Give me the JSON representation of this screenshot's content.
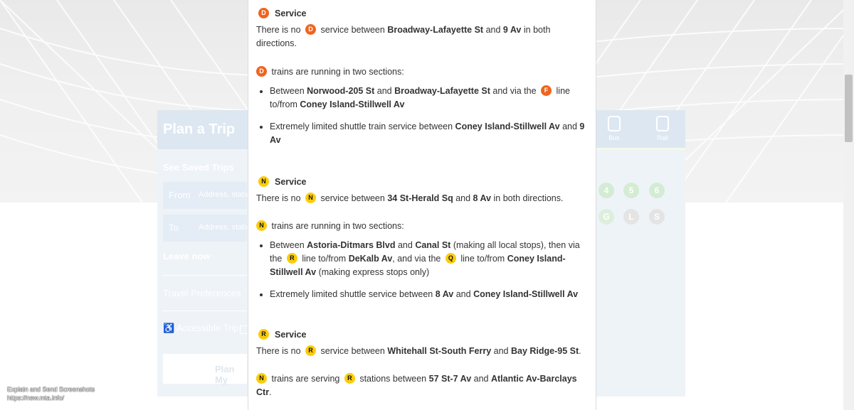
{
  "background_plan": {
    "title": "Plan a Trip",
    "saved_trips": "See Saved Trips",
    "from_label": "From",
    "from_placeholder": "Address, statio",
    "to_label": "To",
    "to_placeholder": "Address, statio",
    "leave_now": "Leave now",
    "travel_preferences": "Travel Preferences",
    "accessible_trip": "Accessible Trip",
    "plan_button": "Plan My",
    "modes": [
      {
        "label": "Bus",
        "icon": "bus-icon"
      },
      {
        "label": "Rail",
        "icon": "rail-icon"
      }
    ],
    "ghost_bullets": [
      "4",
      "5",
      "6",
      "G",
      "L",
      "S"
    ]
  },
  "modal": {
    "sections": [
      {
        "line": "D",
        "color": "#f0641e",
        "header": "Service",
        "p1": {
          "a": "There is no",
          "b": "service between",
          "c": "Broadway-Lafayette St",
          "d": "and",
          "e": "9 Av",
          "f": "in both directions."
        },
        "p2": "trains are running in two sections:",
        "li1": {
          "a": "Between",
          "b": "Norwood-205 St",
          "c": "and",
          "d": "Broadway-Lafayette St",
          "e": "and via the",
          "line": "F",
          "f": "line to/from",
          "g": "Coney Island-Stillwell Av"
        },
        "li2": {
          "a": "Extremely limited shuttle train service between",
          "b": "Coney Island-Stillwell Av",
          "c": "and",
          "d": "9 Av"
        }
      },
      {
        "line": "N",
        "color": "#fccc0a",
        "header": "Service",
        "p1": {
          "a": "There is no",
          "b": "service between",
          "c": "34 St-Herald Sq",
          "d": "and",
          "e": "8 Av",
          "f": "in both directions."
        },
        "p2": "trains are running in two sections:",
        "li1": {
          "a": "Between",
          "b": "Astoria-Ditmars Blvd",
          "c": "and",
          "d": "Canal St",
          "e": "(making all local stops), then via the",
          "line1": "R",
          "f": "line to/from",
          "g": "DeKalb Av",
          "h": ", and via the",
          "line2": "Q",
          "i": "line to/from",
          "j": "Coney Island-Stillwell Av",
          "k": "(making express stops only)"
        },
        "li2": {
          "a": "Extremely limited shuttle service between",
          "b": "8 Av",
          "c": "and",
          "d": "Coney Island-Stillwell Av"
        }
      },
      {
        "line": "R",
        "color": "#fccc0a",
        "header": "Service",
        "p1": {
          "a": "There is no",
          "b": "service between",
          "c": "Whitehall St-South Ferry",
          "d": "and",
          "e": "Bay Ridge-95 St",
          "f": "."
        },
        "p2": {
          "line1": "N",
          "a": "trains are serving",
          "line2": "R",
          "b": "stations between",
          "c": "57 St-7 Av",
          "d": "and",
          "e": "Atlantic Av-Barclays Ctr",
          "f": "."
        }
      }
    ]
  },
  "caption": {
    "line1": "Explain and Send Screenshots",
    "line2": "https://new.mta.info/"
  },
  "colors": {
    "d_line": "#f0641e",
    "nqr_line": "#fccc0a"
  }
}
